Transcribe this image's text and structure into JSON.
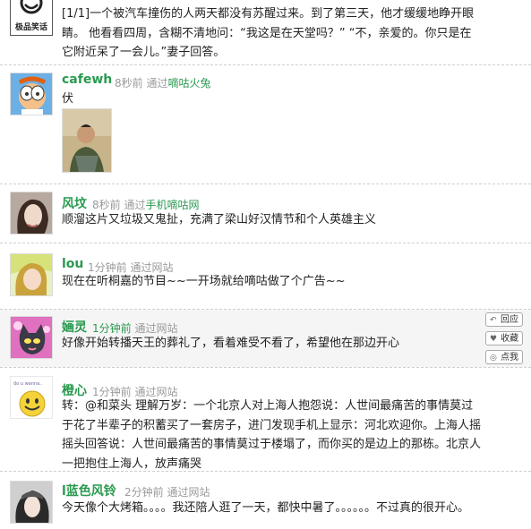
{
  "posts": [
    {
      "name": "",
      "time": "",
      "via_prefix": "",
      "source": "",
      "avatar_caption": "极品笑话",
      "text": "[1/1]一个被汽车撞伤的人两天都没有苏醒过来。到了第三天，他才缓缓地睁开眼睛。 他看看四周，含糊不清地问：“我这是在天堂吗？” “不，亲爱的。你只是在它附近呆了一会儿。”妻子回答。"
    },
    {
      "name": "cafewh",
      "time": "8秒前",
      "via_prefix": "通过",
      "source": "嘀咕火兔",
      "text": "伏"
    },
    {
      "name": "风坟",
      "time": "8秒前",
      "via_prefix": "通过",
      "source": "手机嘀咕网",
      "text": "顺溜这片又垃圾又鬼扯，充满了梁山好汉情节和个人英雄主义"
    },
    {
      "name": "lou",
      "time": "1分钟前",
      "via_prefix": "通过",
      "source": "网站",
      "text": "现在在听桐嘉的节目~~一开场就给嘀咕做了个广告~~"
    },
    {
      "name": "婳灵",
      "time": "1分钟前",
      "via_prefix": "通过",
      "source": "网站",
      "text": "好像开始转播天王的葬礼了，看着难受不看了，希望他在那边开心",
      "actions": [
        "回应",
        "收藏",
        "点我"
      ]
    },
    {
      "name": "橙心",
      "time": "1分钟前",
      "via_prefix": "通过",
      "source": "网站",
      "text": "转：@和菜头 理解万岁：一个北京人对上海人抱怨说：人世间最痛苦的事情莫过于花了半辈子的积蓄买了一套房子，进门发现手机上显示：河北欢迎你。上海人摇摇头回答说：人世间最痛苦的事情莫过于楼塌了，而你买的是边上的那栋。北京人一把抱住上海人，放声痛哭"
    },
    {
      "name": "l蓝色风铃",
      "time": "2分钟前",
      "via_prefix": "通过",
      "source": "网站",
      "text": "今天像个大烤箱。。。。我还陪人逛了一天，都快中暑了。。。。。。不过真的很开心。"
    }
  ],
  "colors": {
    "name": "#2a9a50",
    "meta": "#9a9a9a",
    "highlight_bg": "#f5f5f5"
  }
}
